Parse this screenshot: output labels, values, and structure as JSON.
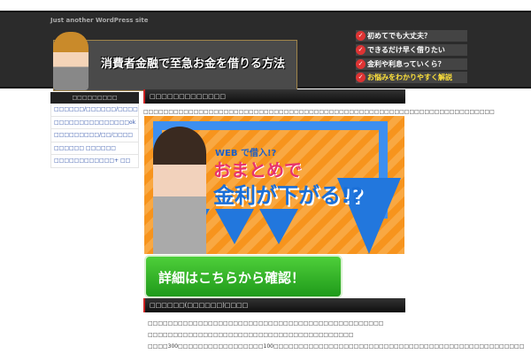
{
  "header": {
    "tagline": "Just another WordPress site",
    "logo_title": "消費者金融で至急お金を借りる方法",
    "faq": [
      "初めてでも大丈夫？",
      "できるだけ早く借りたい",
      "金利や利息っていくら？",
      "お悩みをわかりやすく解説"
    ],
    "check": "✓"
  },
  "sidebar": {
    "title": "□□□□□□□□□",
    "items": [
      "□□□□□□/□□□□□□/□□□□",
      "□□□□□□□□□□□□□□□ok",
      "□□□□□□□□□/□□/□□□□",
      "□□□□□□ □□□□□□",
      "□□□□□□□□□□□□+ □□"
    ]
  },
  "main": {
    "heading1": "□□□□□□□□□□□□□",
    "intro": "□□□□□□□□□□□□□□□□□□□□□□□□□□□□□□□□□□□□□□□□□□□□□□□□□□□□□□□□□□□□□□□□□□□□□□",
    "banner": {
      "line1": "WEB で借入!?",
      "line2": "おまとめで",
      "line3": "金利が下がる!?"
    },
    "cta": "詳細はこちらから確認！",
    "heading2": "□□□□□□(□□□□□□)□□□□",
    "lines": [
      "□□□□□□□□□□□□□□□□□□□□□□□□□□□□□□□□□□□□□□□□□□□□□□□",
      "□□□□□□□□□□□□□□□□□□□□□□□□□□□□□□□□□□□□□□□□□",
      "□□□□300□□□□□□□□□□□□□□□□□100□□□□□□□□□□□□□□□□□□□□□□□□□□□□□□□□□□□□□□□□□□□□□□□□□□"
    ]
  }
}
